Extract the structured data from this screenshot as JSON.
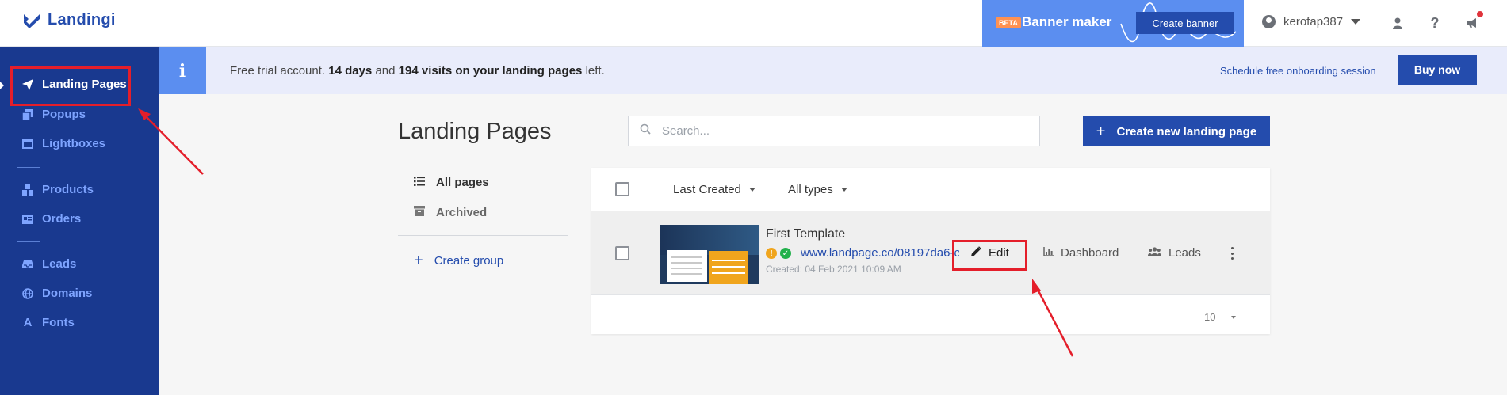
{
  "header": {
    "logo_text": "Landingi",
    "banner": {
      "badge": "BETA",
      "title": "Banner maker",
      "button_label": "Create banner"
    },
    "username": "kerofap387",
    "icons": [
      "user-icon",
      "help-icon",
      "megaphone-icon"
    ]
  },
  "sidebar": {
    "groups": [
      [
        {
          "label": "Landing Pages",
          "icon": "paper-plane-icon",
          "active": true
        },
        {
          "label": "Popups",
          "icon": "popups-icon"
        },
        {
          "label": "Lightboxes",
          "icon": "lightbox-icon"
        }
      ],
      [
        {
          "label": "Products",
          "icon": "boxes-icon"
        },
        {
          "label": "Orders",
          "icon": "orders-icon"
        }
      ],
      [
        {
          "label": "Leads",
          "icon": "inbox-icon"
        },
        {
          "label": "Domains",
          "icon": "globe-icon"
        },
        {
          "label": "Fonts",
          "icon": "font-icon"
        }
      ]
    ]
  },
  "infobar": {
    "text_prefix": "Free trial account.",
    "days": "14 days",
    "text_middle": "and",
    "visits": "194 visits on your landing pages",
    "text_suffix": "left.",
    "schedule_link": "Schedule free onboarding session",
    "buy_button": "Buy now"
  },
  "main": {
    "title": "Landing Pages",
    "search_placeholder": "Search...",
    "create_button": "Create new landing page",
    "left_menu": {
      "all_pages": "All pages",
      "archived": "Archived",
      "create_group": "Create group"
    },
    "filters": {
      "sort": "Last Created",
      "type": "All types"
    },
    "rows": [
      {
        "name": "First Template",
        "url": "www.landpage.co/08197da6-e",
        "created": "Created: 04 Feb 2021 10:09 AM",
        "actions": {
          "edit": "Edit",
          "dashboard": "Dashboard",
          "leads": "Leads"
        }
      }
    ],
    "per_page": "10"
  },
  "colors": {
    "primary": "#244cad",
    "sidebar": "#19398f",
    "sidebar_link": "#7ea4ff",
    "banner": "#5b8ef0",
    "annotation": "#e41e2a",
    "warning": "#f0a51d",
    "success": "#22b14c"
  }
}
